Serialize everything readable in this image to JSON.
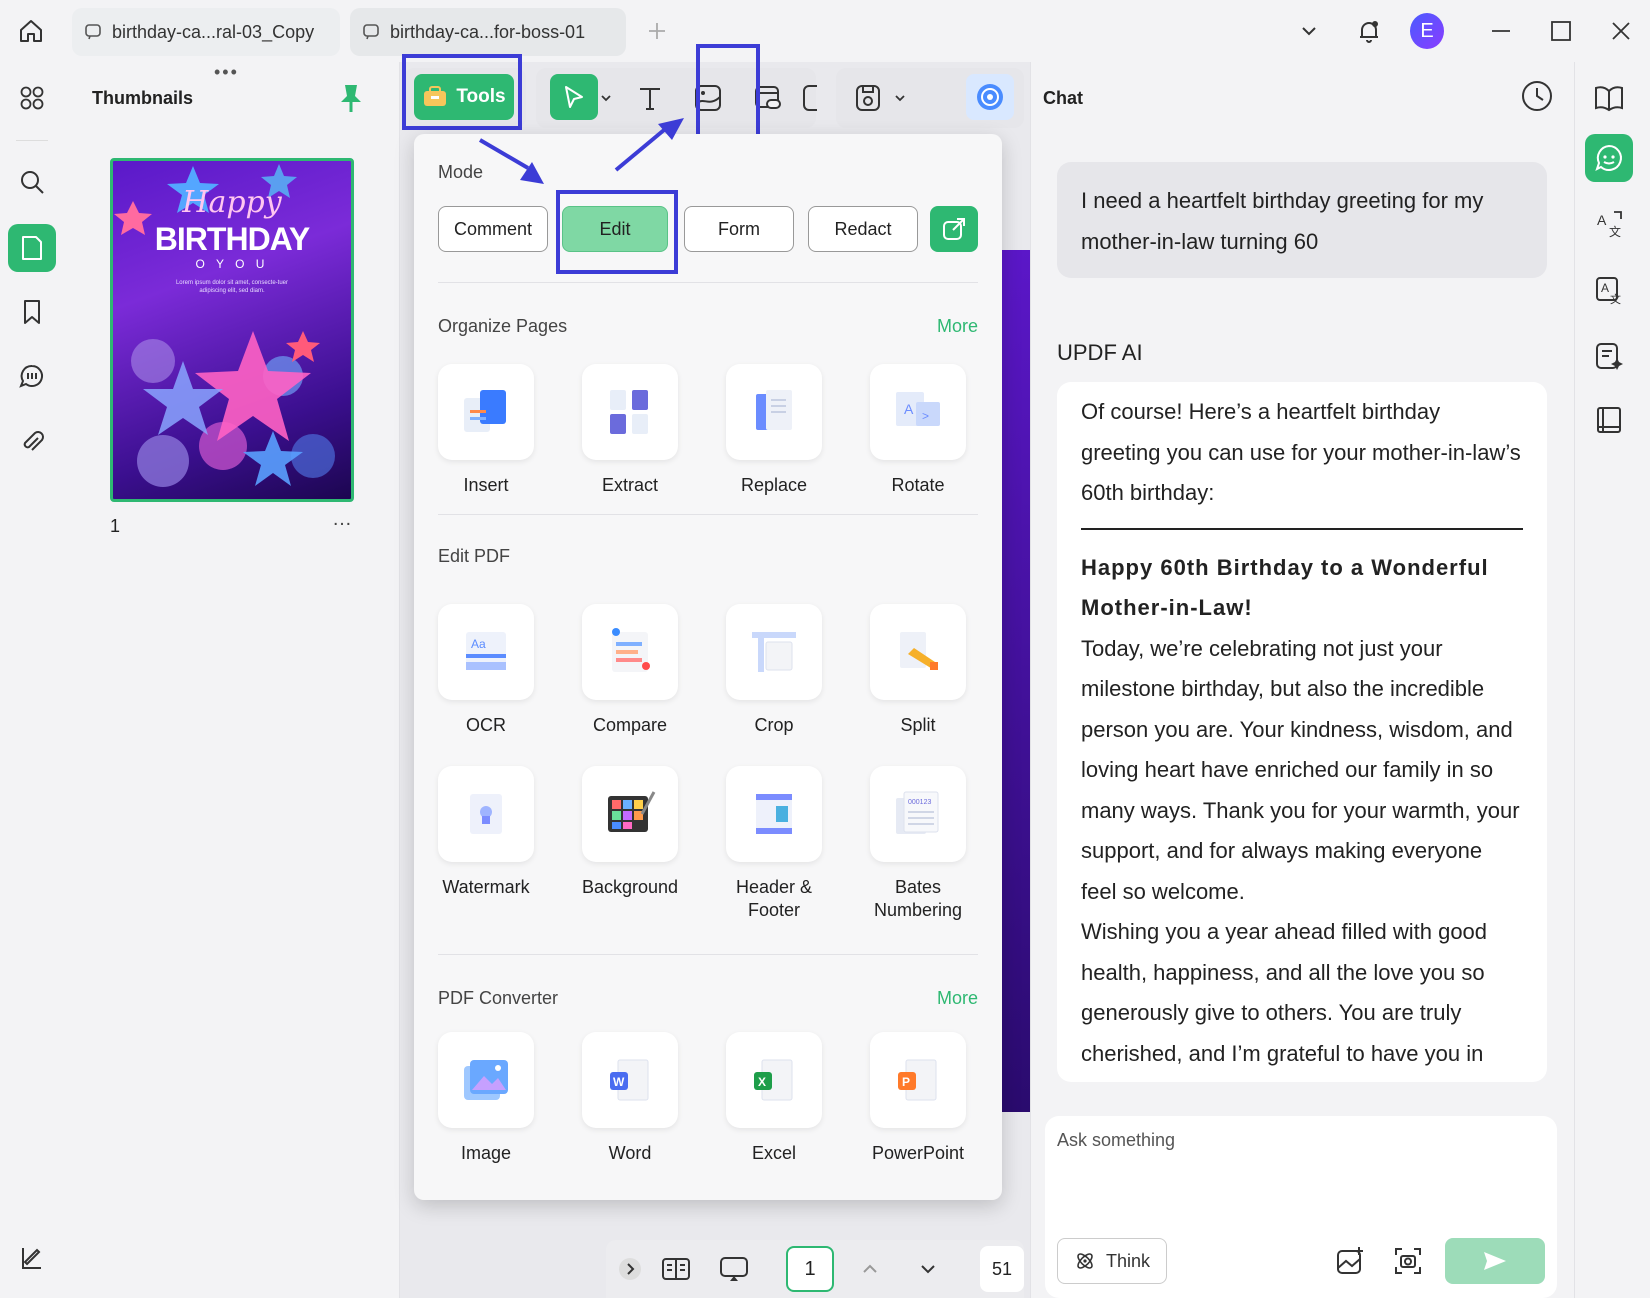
{
  "window": {
    "tabs": [
      {
        "label": "birthday-ca...ral-03_Copy"
      },
      {
        "label": "birthday-ca...for-boss-01"
      }
    ],
    "avatar_letter": "E",
    "accent_color": "#2eb872",
    "highlight_color": "#3c3cd6"
  },
  "thumbnails": {
    "title": "Thumbnails",
    "page_label": "1",
    "more": "…",
    "drag_handle": "•••",
    "cover": {
      "line1": "Happy",
      "line2": "BIRTHDAY",
      "line3": "O   Y O U",
      "small_text": "Lorem ipsum dolor sit amet, consecte-tuer adipiscing elit, sed diam."
    }
  },
  "toolbar": {
    "tools_label": "Tools"
  },
  "tools_panel": {
    "mode_title": "Mode",
    "modes": [
      {
        "label": "Comment"
      },
      {
        "label": "Edit"
      },
      {
        "label": "Form"
      },
      {
        "label": "Redact"
      }
    ],
    "organize": {
      "title": "Organize Pages",
      "more": "More",
      "items": [
        {
          "label": "Insert"
        },
        {
          "label": "Extract"
        },
        {
          "label": "Replace"
        },
        {
          "label": "Rotate"
        }
      ]
    },
    "edit_pdf": {
      "title": "Edit PDF",
      "items": [
        {
          "label": "OCR"
        },
        {
          "label": "Compare"
        },
        {
          "label": "Crop"
        },
        {
          "label": "Split"
        },
        {
          "label": "Watermark"
        },
        {
          "label": "Background"
        },
        {
          "label": "Header & Footer"
        },
        {
          "label": "Bates Numbering"
        }
      ]
    },
    "converter": {
      "title": "PDF Converter",
      "more": "More",
      "items": [
        {
          "label": "Image"
        },
        {
          "label": "Word"
        },
        {
          "label": "Excel"
        },
        {
          "label": "PowerPoint"
        }
      ]
    }
  },
  "bottombar": {
    "current_page": "1",
    "zoom": "51"
  },
  "chat": {
    "title": "Chat",
    "user_message": "I need a heartfelt birthday greeting for my mother-in-law turning 60",
    "ai_label": "UPDF AI",
    "ai_intro": "Of course! Here’s a heartfelt birthday greeting you can use for your mother-in-law’s 60th birthday:",
    "ai_heading": "Happy 60th Birthday to a Wonderful Mother-in-Law!",
    "ai_para1": "Today, we’re celebrating not just your milestone birthday, but also the incredible person you are. Your kindness, wisdom, and loving heart have enriched our family in so many ways. Thank you for your warmth, your support, and for always making everyone feel so welcome.",
    "ai_para2": "Wishing you a year ahead filled with good health, happiness, and all the love you so generously give to others. You are truly cherished, and I’m grateful to have you in",
    "input_placeholder": "Ask something",
    "think_label": "Think"
  }
}
